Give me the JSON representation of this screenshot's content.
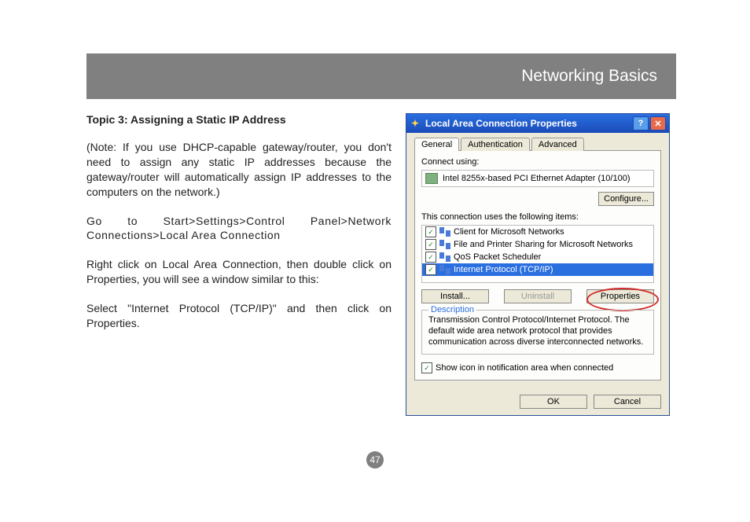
{
  "banner_title": "Networking Basics",
  "topic_title": "Topic 3: Assigning a Static IP Address",
  "para_note": "(Note: If you use DHCP-capable gateway/router, you don't need to assign any static IP addresses because the gateway/router will automatically assign IP addresses to the computers on the network.)",
  "para_nav": "Go to Start>Settings>Control Panel>Network Connections>Local Area Connection",
  "para_rightclick": "Right click on Local Area Connection, then double click on Properties, you will see a window similar to this:",
  "para_select": "Select \"Internet Protocol (TCP/IP)\" and then click on Properties.",
  "page_number": "47",
  "dialog": {
    "title": "Local Area Connection Properties",
    "tabs": {
      "general": "General",
      "auth": "Authentication",
      "advanced": "Advanced"
    },
    "connect_using_label": "Connect using:",
    "adapter": "Intel 8255x-based PCI Ethernet Adapter (10/100)",
    "configure_btn": "Configure...",
    "items_label": "This connection uses the following items:",
    "items": [
      {
        "label": "Client for Microsoft Networks"
      },
      {
        "label": "File and Printer Sharing for Microsoft Networks"
      },
      {
        "label": "QoS Packet Scheduler"
      },
      {
        "label": "Internet Protocol (TCP/IP)"
      }
    ],
    "install_btn": "Install...",
    "uninstall_btn": "Uninstall",
    "properties_btn": "Properties",
    "desc_label": "Description",
    "desc_text": "Transmission Control Protocol/Internet Protocol. The default wide area network protocol that provides communication across diverse interconnected networks.",
    "show_icon_label": "Show icon in notification area when connected",
    "ok_btn": "OK",
    "cancel_btn": "Cancel"
  }
}
